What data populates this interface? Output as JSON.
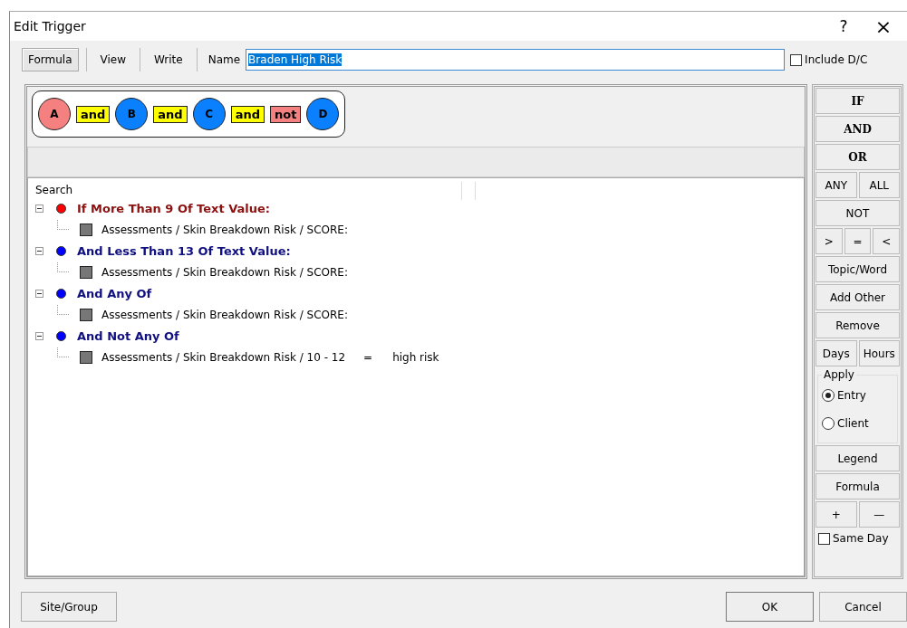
{
  "window": {
    "title": "Edit Trigger",
    "help": "?",
    "close": "×"
  },
  "tabs": [
    {
      "label": "Formula",
      "selected": true
    },
    {
      "label": "View",
      "selected": false
    },
    {
      "label": "Write",
      "selected": false
    }
  ],
  "name_field": {
    "label": "Name",
    "value": "Braden High Risk"
  },
  "include_dc": {
    "label": "Include D/C",
    "checked": false
  },
  "formula": [
    {
      "kind": "term",
      "label": "A",
      "color": "#f48080"
    },
    {
      "kind": "op",
      "label": "and",
      "color": "#ffff00"
    },
    {
      "kind": "term",
      "label": "B",
      "color": "#0a80ff"
    },
    {
      "kind": "op",
      "label": "and",
      "color": "#ffff00"
    },
    {
      "kind": "term",
      "label": "C",
      "color": "#0a80ff"
    },
    {
      "kind": "op",
      "label": "and",
      "color": "#ffff00"
    },
    {
      "kind": "op",
      "label": "not",
      "color": "#f48080"
    },
    {
      "kind": "term",
      "label": "D",
      "color": "#0a80ff"
    }
  ],
  "tree": {
    "header": "Search",
    "items": [
      {
        "label": "If More Than 9 Of Text Value:",
        "color": "#ff0000",
        "expanded": true,
        "children": [
          {
            "path": "Assessments / Skin Breakdown Risk / SCORE:"
          }
        ]
      },
      {
        "label": "And Less Than 13 Of Text Value:",
        "color": "#0000ff",
        "expanded": true,
        "children": [
          {
            "path": "Assessments / Skin Breakdown Risk / SCORE:"
          }
        ]
      },
      {
        "label": "And Any Of",
        "color": "#0000ff",
        "expanded": true,
        "children": [
          {
            "path": "Assessments / Skin Breakdown Risk / SCORE:"
          }
        ]
      },
      {
        "label": "And Not Any Of",
        "color": "#0000ff",
        "expanded": true,
        "children": [
          {
            "path": "Assessments / Skin Breakdown Risk / 10 - 12",
            "operator": "=",
            "value": "high risk"
          }
        ]
      }
    ]
  },
  "side_buttons": [
    [
      {
        "label": "IF",
        "bold": true
      }
    ],
    [
      {
        "label": "AND",
        "bold": true
      }
    ],
    [
      {
        "label": "OR",
        "bold": true
      }
    ],
    [
      {
        "label": "ANY",
        "bold": false
      },
      {
        "label": "ALL",
        "bold": false
      }
    ],
    [
      {
        "label": "NOT",
        "bold": false
      }
    ],
    [
      {
        "label": ">",
        "bold": false
      },
      {
        "label": "=",
        "bold": false
      },
      {
        "label": "<",
        "bold": false
      }
    ],
    [
      {
        "label": "Topic/Word",
        "bold": false
      }
    ],
    [
      {
        "label": "Add Other",
        "bold": false
      }
    ],
    [
      {
        "label": "Remove",
        "bold": false
      }
    ],
    [
      {
        "label": "Days",
        "bold": false
      },
      {
        "label": "Hours",
        "bold": false
      }
    ]
  ],
  "apply": {
    "label": "Apply",
    "options": [
      {
        "label": "Entry",
        "selected": true
      },
      {
        "label": "Client",
        "selected": false
      }
    ]
  },
  "side_buttons_2": [
    [
      {
        "label": "Legend",
        "bold": false
      }
    ],
    [
      {
        "label": "Formula",
        "bold": false
      }
    ],
    [
      {
        "label": "+",
        "bold": false
      },
      {
        "label": "—",
        "bold": false
      }
    ]
  ],
  "same_day": {
    "label": "Same Day",
    "checked": false
  },
  "footer": {
    "left": "Site/Group",
    "ok": "OK",
    "cancel": "Cancel"
  }
}
